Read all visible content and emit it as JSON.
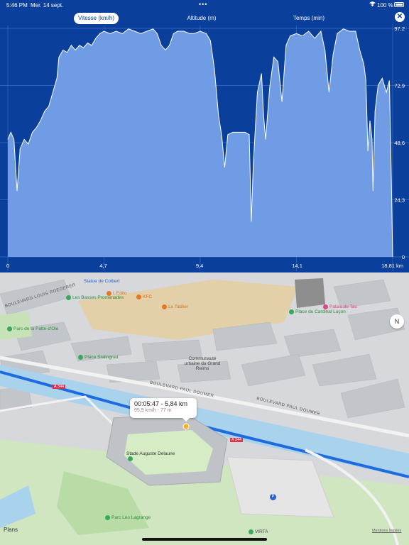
{
  "status_bar": {
    "time": "5:46 PM",
    "date": "Mer. 14 sept.",
    "dots": "•••",
    "wifi_icon": "wifi-icon",
    "battery_text": "100 %",
    "battery_icon": "battery-icon"
  },
  "tabs": [
    {
      "label": "Vitesse (km/h)",
      "active": true
    },
    {
      "label": "Altitude (m)",
      "active": false
    },
    {
      "label": "Temps (min)",
      "active": false
    }
  ],
  "close_icon": "close-icon",
  "chart_data": {
    "type": "area",
    "x_unit": "km",
    "xlim": [
      0,
      18.81
    ],
    "ylim": [
      0,
      97.2
    ],
    "y_ticks": [
      "97,2",
      "72,9",
      "48,6",
      "24,3",
      "0"
    ],
    "x_ticks": [
      "0",
      "4,7",
      "9,4",
      "14,1",
      "18,81 km"
    ],
    "x_tick_values": [
      0,
      4.7,
      9.4,
      14.1,
      18.81
    ],
    "grid": true,
    "colors": {
      "fill": "#6f9ce4",
      "line": "#ffffff",
      "background": "#0b3f9c",
      "grid": "#3d6cc0"
    },
    "points": [
      [
        0,
        50
      ],
      [
        0.15,
        53
      ],
      [
        0.3,
        50
      ],
      [
        0.45,
        28
      ],
      [
        0.6,
        46
      ],
      [
        0.8,
        50
      ],
      [
        1.0,
        48
      ],
      [
        1.2,
        53
      ],
      [
        1.4,
        55
      ],
      [
        1.6,
        58
      ],
      [
        1.8,
        62
      ],
      [
        2.0,
        64
      ],
      [
        2.2,
        70
      ],
      [
        2.4,
        76
      ],
      [
        2.5,
        85
      ],
      [
        2.7,
        88
      ],
      [
        2.9,
        87
      ],
      [
        3.1,
        90
      ],
      [
        3.3,
        88
      ],
      [
        3.5,
        90
      ],
      [
        3.7,
        89
      ],
      [
        3.9,
        91
      ],
      [
        4.1,
        90
      ],
      [
        4.3,
        93
      ],
      [
        4.5,
        95
      ],
      [
        4.7,
        96
      ],
      [
        5.0,
        95
      ],
      [
        5.3,
        96
      ],
      [
        5.6,
        95
      ],
      [
        5.9,
        97
      ],
      [
        6.2,
        96
      ],
      [
        6.5,
        95
      ],
      [
        6.8,
        96
      ],
      [
        7.1,
        97
      ],
      [
        7.3,
        95
      ],
      [
        7.5,
        90
      ],
      [
        7.7,
        88
      ],
      [
        7.9,
        90
      ],
      [
        8.1,
        95
      ],
      [
        8.3,
        96
      ],
      [
        8.6,
        96
      ],
      [
        8.9,
        95
      ],
      [
        9.1,
        95
      ],
      [
        9.4,
        96
      ],
      [
        9.7,
        95
      ],
      [
        9.9,
        92
      ],
      [
        10.1,
        80
      ],
      [
        10.3,
        60
      ],
      [
        10.45,
        52
      ],
      [
        10.6,
        38
      ],
      [
        10.75,
        52
      ],
      [
        11.0,
        53
      ],
      [
        11.3,
        53
      ],
      [
        11.6,
        53
      ],
      [
        11.8,
        52
      ],
      [
        11.9,
        15
      ],
      [
        12.0,
        40
      ],
      [
        12.2,
        70
      ],
      [
        12.4,
        78
      ],
      [
        12.5,
        60
      ],
      [
        12.6,
        50
      ],
      [
        12.8,
        72
      ],
      [
        13.0,
        85
      ],
      [
        13.2,
        83
      ],
      [
        13.4,
        66
      ],
      [
        13.6,
        90
      ],
      [
        13.8,
        94
      ],
      [
        14.1,
        95
      ],
      [
        14.4,
        94
      ],
      [
        14.7,
        96
      ],
      [
        15.0,
        93
      ],
      [
        15.3,
        96
      ],
      [
        15.5,
        88
      ],
      [
        15.7,
        70
      ],
      [
        15.9,
        86
      ],
      [
        16.1,
        95
      ],
      [
        16.4,
        97
      ],
      [
        16.7,
        96
      ],
      [
        17.0,
        96
      ],
      [
        17.2,
        88
      ],
      [
        17.4,
        82
      ],
      [
        17.5,
        75
      ],
      [
        17.6,
        45
      ],
      [
        17.7,
        58
      ],
      [
        17.8,
        50
      ],
      [
        17.85,
        28
      ],
      [
        17.95,
        62
      ],
      [
        18.1,
        73
      ],
      [
        18.3,
        76
      ],
      [
        18.5,
        70
      ],
      [
        18.65,
        75
      ],
      [
        18.75,
        30
      ],
      [
        18.81,
        0
      ]
    ]
  },
  "map": {
    "tooltip": {
      "title": "00:05:47 - 5,84 km",
      "subtitle": "95,9 km/h - 77 m"
    },
    "compass_label": "N",
    "labels": {
      "statue": "Statue de Colbert",
      "leditor": "L'Edito",
      "kfc": "KFC",
      "basses": "Les Basses Promenades",
      "tablier": "Le Tablier",
      "palais": "Palais du Tau",
      "place_luçon": "Place du Cardinal Luçon",
      "patte": "Parc de la Patte-d'Oie",
      "stalingrad": "Place Stalingrad",
      "communaute": "Communauté urbaine du Grand Reims",
      "stade": "Stade Auguste Delaune",
      "leo": "Parc Léo Lagrange",
      "virta": "VIRTA",
      "bd_roederer": "BOULEVARD LOUIS ROEDERER",
      "bd_doumer": "BOULEVARD PAUL DOUMER",
      "bd_doumer2": "BOULEVARD PAUL DOUMER",
      "a344": "A 344",
      "a344b": "A 344"
    },
    "plans_label": "Plans",
    "legal_label": "Mentions légales"
  }
}
